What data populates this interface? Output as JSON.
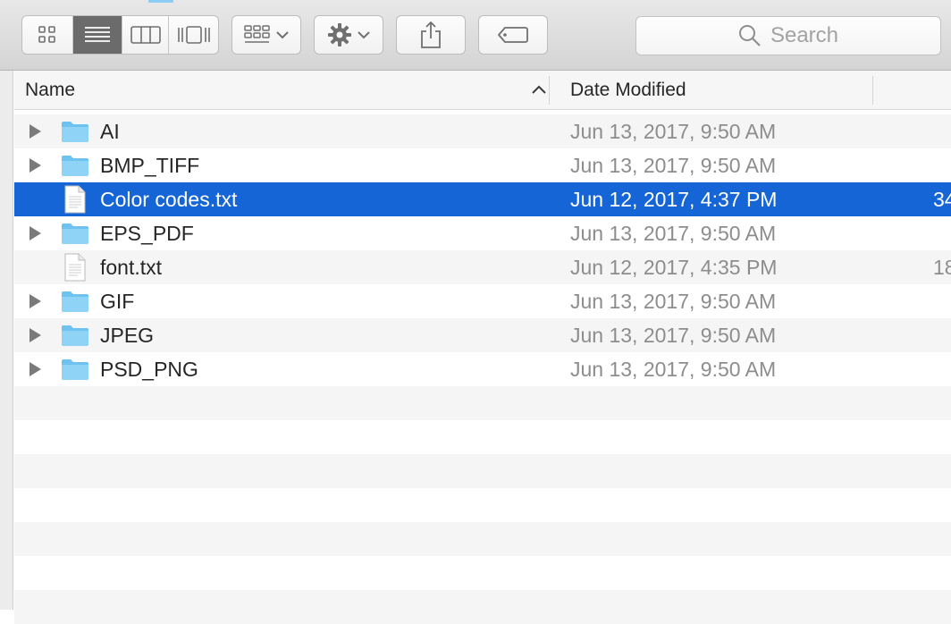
{
  "toolbar": {
    "view_buttons": [
      {
        "name": "icon-view",
        "icon": "grid-icon",
        "active": false
      },
      {
        "name": "list-view",
        "icon": "list-icon",
        "active": true
      },
      {
        "name": "column-view",
        "icon": "columns-icon",
        "active": false
      },
      {
        "name": "cover-flow-view",
        "icon": "cover-flow-icon",
        "active": false
      }
    ],
    "arrange_icon": "arrange-grid-icon",
    "action_icon": "gear-icon",
    "share_icon": "share-icon",
    "tags_icon": "tag-icon",
    "search_placeholder": "Search",
    "search_icon": "magnifier-icon"
  },
  "columns": {
    "name": "Name",
    "date_modified": "Date Modified",
    "sort_indicator": "ascending"
  },
  "files": [
    {
      "name": "AI",
      "kind": "folder",
      "date": "Jun 13, 2017, 9:50 AM",
      "size": ""
    },
    {
      "name": "BMP_TIFF",
      "kind": "folder",
      "date": "Jun 13, 2017, 9:50 AM",
      "size": ""
    },
    {
      "name": "Color codes.txt",
      "kind": "file",
      "date": "Jun 12, 2017, 4:37 PM",
      "size": "34",
      "selected": true
    },
    {
      "name": "EPS_PDF",
      "kind": "folder",
      "date": "Jun 13, 2017, 9:50 AM",
      "size": ""
    },
    {
      "name": "font.txt",
      "kind": "file",
      "date": "Jun 12, 2017, 4:35 PM",
      "size": "18"
    },
    {
      "name": "GIF",
      "kind": "folder",
      "date": "Jun 13, 2017, 9:50 AM",
      "size": ""
    },
    {
      "name": "JPEG",
      "kind": "folder",
      "date": "Jun 13, 2017, 9:50 AM",
      "size": ""
    },
    {
      "name": "PSD_PNG",
      "kind": "folder",
      "date": "Jun 13, 2017, 9:50 AM",
      "size": ""
    }
  ],
  "colors": {
    "selection": "#1565d6",
    "folder": "#7ccbf4",
    "stripe": "#f5f5f5"
  }
}
